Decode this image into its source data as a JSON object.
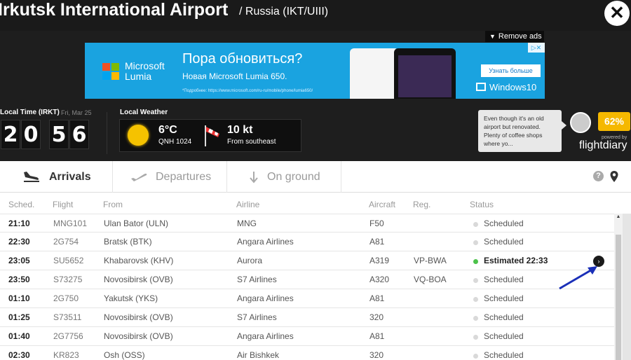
{
  "header": {
    "title": "Irkutsk International Airport",
    "subtitle": "/ Russia (IKT/UIII)",
    "close_glyph": "✕"
  },
  "ads": {
    "remove_label": "Remove ads",
    "brand_line1": "Microsoft",
    "brand_line2": "Lumia",
    "headline": "Пора обновиться?",
    "subline": "Новая Microsoft Lumia 650.",
    "fine_print": "*Подробнее: https://www.microsoft.com/ru-ru/mobile/phone/lumia650/",
    "cta": "Узнать больше",
    "windows": "Windows10"
  },
  "clock": {
    "label": "Local Time (IRKT)",
    "date": "Fri, Mar 25",
    "digits": [
      "2",
      "0",
      "5",
      "6"
    ]
  },
  "weather": {
    "label": "Local Weather",
    "temp": "6°C",
    "qnh": "QNH 1024",
    "wind": "10 kt",
    "wind_dir": "From southeast"
  },
  "review": {
    "text": "Even though it's an old airport but renovated. Plenty of coffee shops where yo...",
    "rating": "62%",
    "powered": "powered by",
    "logo": "flightdiary"
  },
  "tabs": [
    {
      "label": "Arrivals",
      "icon": "plane-landing-icon"
    },
    {
      "label": "Departures",
      "icon": "plane-takeoff-icon"
    },
    {
      "label": "On ground",
      "icon": "arrow-down-icon"
    }
  ],
  "help_glyph": "?",
  "table": {
    "headers": [
      "Sched.",
      "Flight",
      "From",
      "Airline",
      "Aircraft",
      "Reg.",
      "Status"
    ],
    "rows": [
      {
        "sched": "21:10",
        "flight": "MNG101",
        "from": "Ulan Bator (ULN)",
        "airline": "MNG",
        "aircraft": "F50",
        "reg": "",
        "status": "Scheduled"
      },
      {
        "sched": "22:30",
        "flight": "2G754",
        "from": "Bratsk (BTK)",
        "airline": "Angara Airlines",
        "aircraft": "A81",
        "reg": "",
        "status": "Scheduled"
      },
      {
        "sched": "23:05",
        "flight": "SU5652",
        "from": "Khabarovsk (KHV)",
        "airline": "Aurora",
        "aircraft": "A319",
        "reg": "VP-BWA",
        "status": "Estimated 22:33"
      },
      {
        "sched": "23:50",
        "flight": "S73275",
        "from": "Novosibirsk (OVB)",
        "airline": "S7 Airlines",
        "aircraft": "A320",
        "reg": "VQ-BOA",
        "status": "Scheduled"
      },
      {
        "sched": "01:10",
        "flight": "2G750",
        "from": "Yakutsk (YKS)",
        "airline": "Angara Airlines",
        "aircraft": "A81",
        "reg": "",
        "status": "Scheduled"
      },
      {
        "sched": "01:25",
        "flight": "S73511",
        "from": "Novosibirsk (OVB)",
        "airline": "S7 Airlines",
        "aircraft": "320",
        "reg": "",
        "status": "Scheduled"
      },
      {
        "sched": "01:40",
        "flight": "2G7756",
        "from": "Novosibirsk (OVB)",
        "airline": "Angara Airlines",
        "aircraft": "A81",
        "reg": "",
        "status": "Scheduled"
      },
      {
        "sched": "02:30",
        "flight": "KR823",
        "from": "Osh (OSS)",
        "airline": "Air Bishkek",
        "aircraft": "320",
        "reg": "",
        "status": "Scheduled"
      }
    ],
    "detail_glyph": "›"
  },
  "colors": {
    "background": "#1e1e1e",
    "ad_blue": "#1aa3e0",
    "rating": "#f5b800",
    "status_green": "#4cc24a",
    "annotation_arrow": "#1a2fb8"
  }
}
